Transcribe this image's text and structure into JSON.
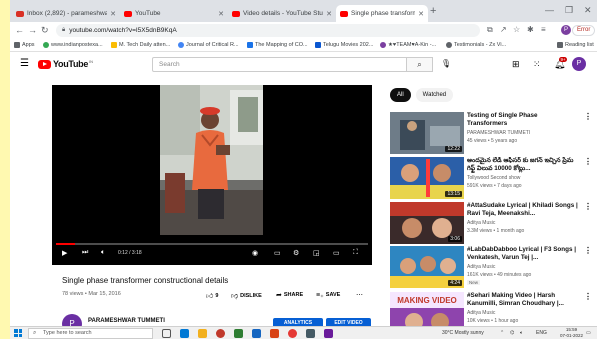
{
  "browser": {
    "tabs": [
      {
        "label": "Inbox (2,892) - parameshwar@...",
        "color": "#d93025"
      },
      {
        "label": "YouTube",
        "color": "#ff0000"
      },
      {
        "label": "Video details - YouTube Stu...",
        "color": "#ff0000"
      },
      {
        "label": "Single phase transformer co...",
        "color": "#ff0000"
      }
    ],
    "url": "youtube.com/watch?v=I5X5dnB9KqA",
    "profile_initial": "P",
    "error_label": "Error",
    "bookmarks": [
      {
        "label": "Apps",
        "color": "#5f6368"
      },
      {
        "label": "www.indianpostexa...",
        "color": "#34a853"
      },
      {
        "label": "M. Tech Daily atten...",
        "color": "#fbbc04"
      },
      {
        "label": "Journal of Critical R...",
        "color": "#4285f4"
      },
      {
        "label": "The Mapping of CO...",
        "color": "#1a73e8"
      },
      {
        "label": "Telugu Movies 202...",
        "color": "#0b57d0"
      },
      {
        "label": "★♥TEAM♥A-Kin -...",
        "color": "#7b3fa0"
      },
      {
        "label": "Testimonials - Zx Vi...",
        "color": "#5f6368"
      },
      {
        "label": "Reading list",
        "color": "#5f6368"
      }
    ]
  },
  "youtube": {
    "logo": "YouTube",
    "logo_country": "IN",
    "search_placeholder": "Search",
    "notifications_count": "9+",
    "avatar_initial": "P"
  },
  "video": {
    "title": "Single phase transformer constructional details",
    "meta": "78 views • Mar 15, 2016",
    "timecode": "0:12 / 3:18",
    "progress": 0.06,
    "likes": "9",
    "dislike_label": "DISLIKE",
    "share_label": "SHARE",
    "save_label": "SAVE",
    "channel_name": "PARAMESHWAR TUMMETI",
    "channel_initial": "P",
    "analytics_label": "ANALYTICS",
    "edit_label": "EDIT VIDEO"
  },
  "sidebar": {
    "chips": [
      "All",
      "Watched"
    ],
    "items": [
      {
        "title": "Testing of Single Phase Transformers",
        "channel": "PARAMESHWAR TUMMETI",
        "meta": "45 views • 5 years ago",
        "duration": "12:22",
        "new": "",
        "thumb_color": "#5a6a7a"
      },
      {
        "title": "అందమైన లేడీ ఆఫీసర్ కు జగన్ ఇచ్చిన ప్రేమ గిఫ్ట్ విలువ 10000 కోట్లు...",
        "channel": "Tollywood Second show",
        "meta": "591K views • 7 days ago",
        "duration": "13:15",
        "new": "",
        "thumb_color": "#2b5fa8"
      },
      {
        "title": "#AttaSudake Lyrical | Khiladi Songs | Ravi Teja, Meenakshi...",
        "channel": "Aditya Music",
        "meta": "3.3M views • 1 month ago",
        "duration": "3:06",
        "new": "",
        "thumb_color": "#c0392b"
      },
      {
        "title": "#LabDabDabboo Lyrical | F3 Songs | Venkatesh, Varun Tej |...",
        "channel": "Aditya Music",
        "meta": "161K views • 49 minutes ago",
        "duration": "4:24",
        "new": "New",
        "thumb_color": "#2e86c1"
      },
      {
        "title": "#Sehari Making Video | Harsh Kanumilli, Simran Choudhary |...",
        "channel": "Aditya Music",
        "meta": "10K views • 1 hour ago",
        "duration": "",
        "new": "",
        "thumb_color": "#8e44ad",
        "thumb_text": "MAKING VIDEO"
      }
    ]
  },
  "taskbar": {
    "search_placeholder": "Type here to search",
    "weather": "30°C  Mostly sunny",
    "language": "ENG",
    "time": "15:59",
    "date": "07-01-2022"
  }
}
